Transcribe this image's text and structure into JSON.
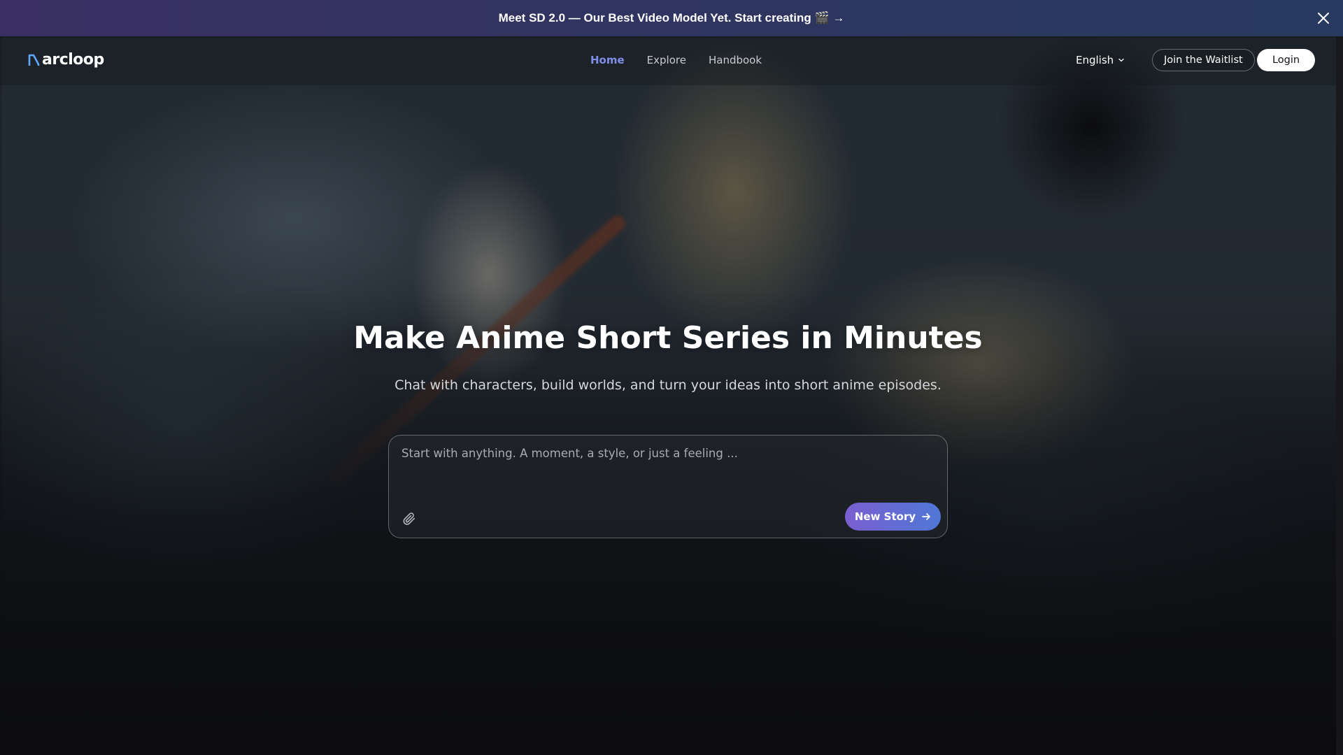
{
  "banner": {
    "text": "Meet SD 2.0 — Our Best Video Model Yet. Start creating 🎬 →",
    "close_icon": "close-icon"
  },
  "nav": {
    "logo_text": "arcloop",
    "links": [
      {
        "label": "Home",
        "active": true
      },
      {
        "label": "Explore",
        "active": false
      },
      {
        "label": "Handbook",
        "active": false
      }
    ],
    "language": "English",
    "waitlist_label": "Join the Waitlist",
    "login_label": "Login"
  },
  "hero": {
    "title": "Make Anime Short Series in Minutes",
    "subtitle": "Chat with characters, build worlds, and turn your ideas into short anime episodes.",
    "prompt_placeholder": "Start with anything. A moment, a style, or just a feeling ...",
    "attach_icon": "paperclip-icon",
    "new_story_label": "New Story",
    "new_story_icon": "arrow-right-icon"
  },
  "colors": {
    "accent_active": "#7f8ee6",
    "button_gradient_start": "#7a5fd0",
    "button_gradient_end": "#4f77d6",
    "banner_bg": "#2f3560"
  }
}
